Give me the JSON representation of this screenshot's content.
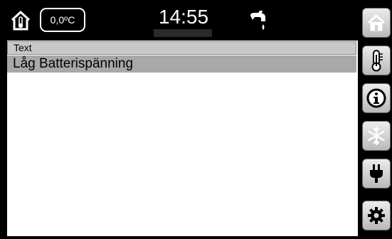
{
  "header": {
    "temperature": "0,0ºC",
    "time": "14:55",
    "icons": [
      "home-thermometer-icon",
      "water-tap-icon"
    ]
  },
  "panel": {
    "column_header": "Text",
    "rows": [
      {
        "text": "Låg Batterispänning"
      }
    ]
  },
  "sidebar": {
    "buttons": [
      {
        "icon": "home-icon"
      },
      {
        "icon": "thermometer-icon"
      },
      {
        "icon": "info-icon"
      },
      {
        "icon": "snowflake-icon"
      },
      {
        "icon": "power-plug-icon"
      },
      {
        "icon": "gear-icon"
      }
    ]
  }
}
